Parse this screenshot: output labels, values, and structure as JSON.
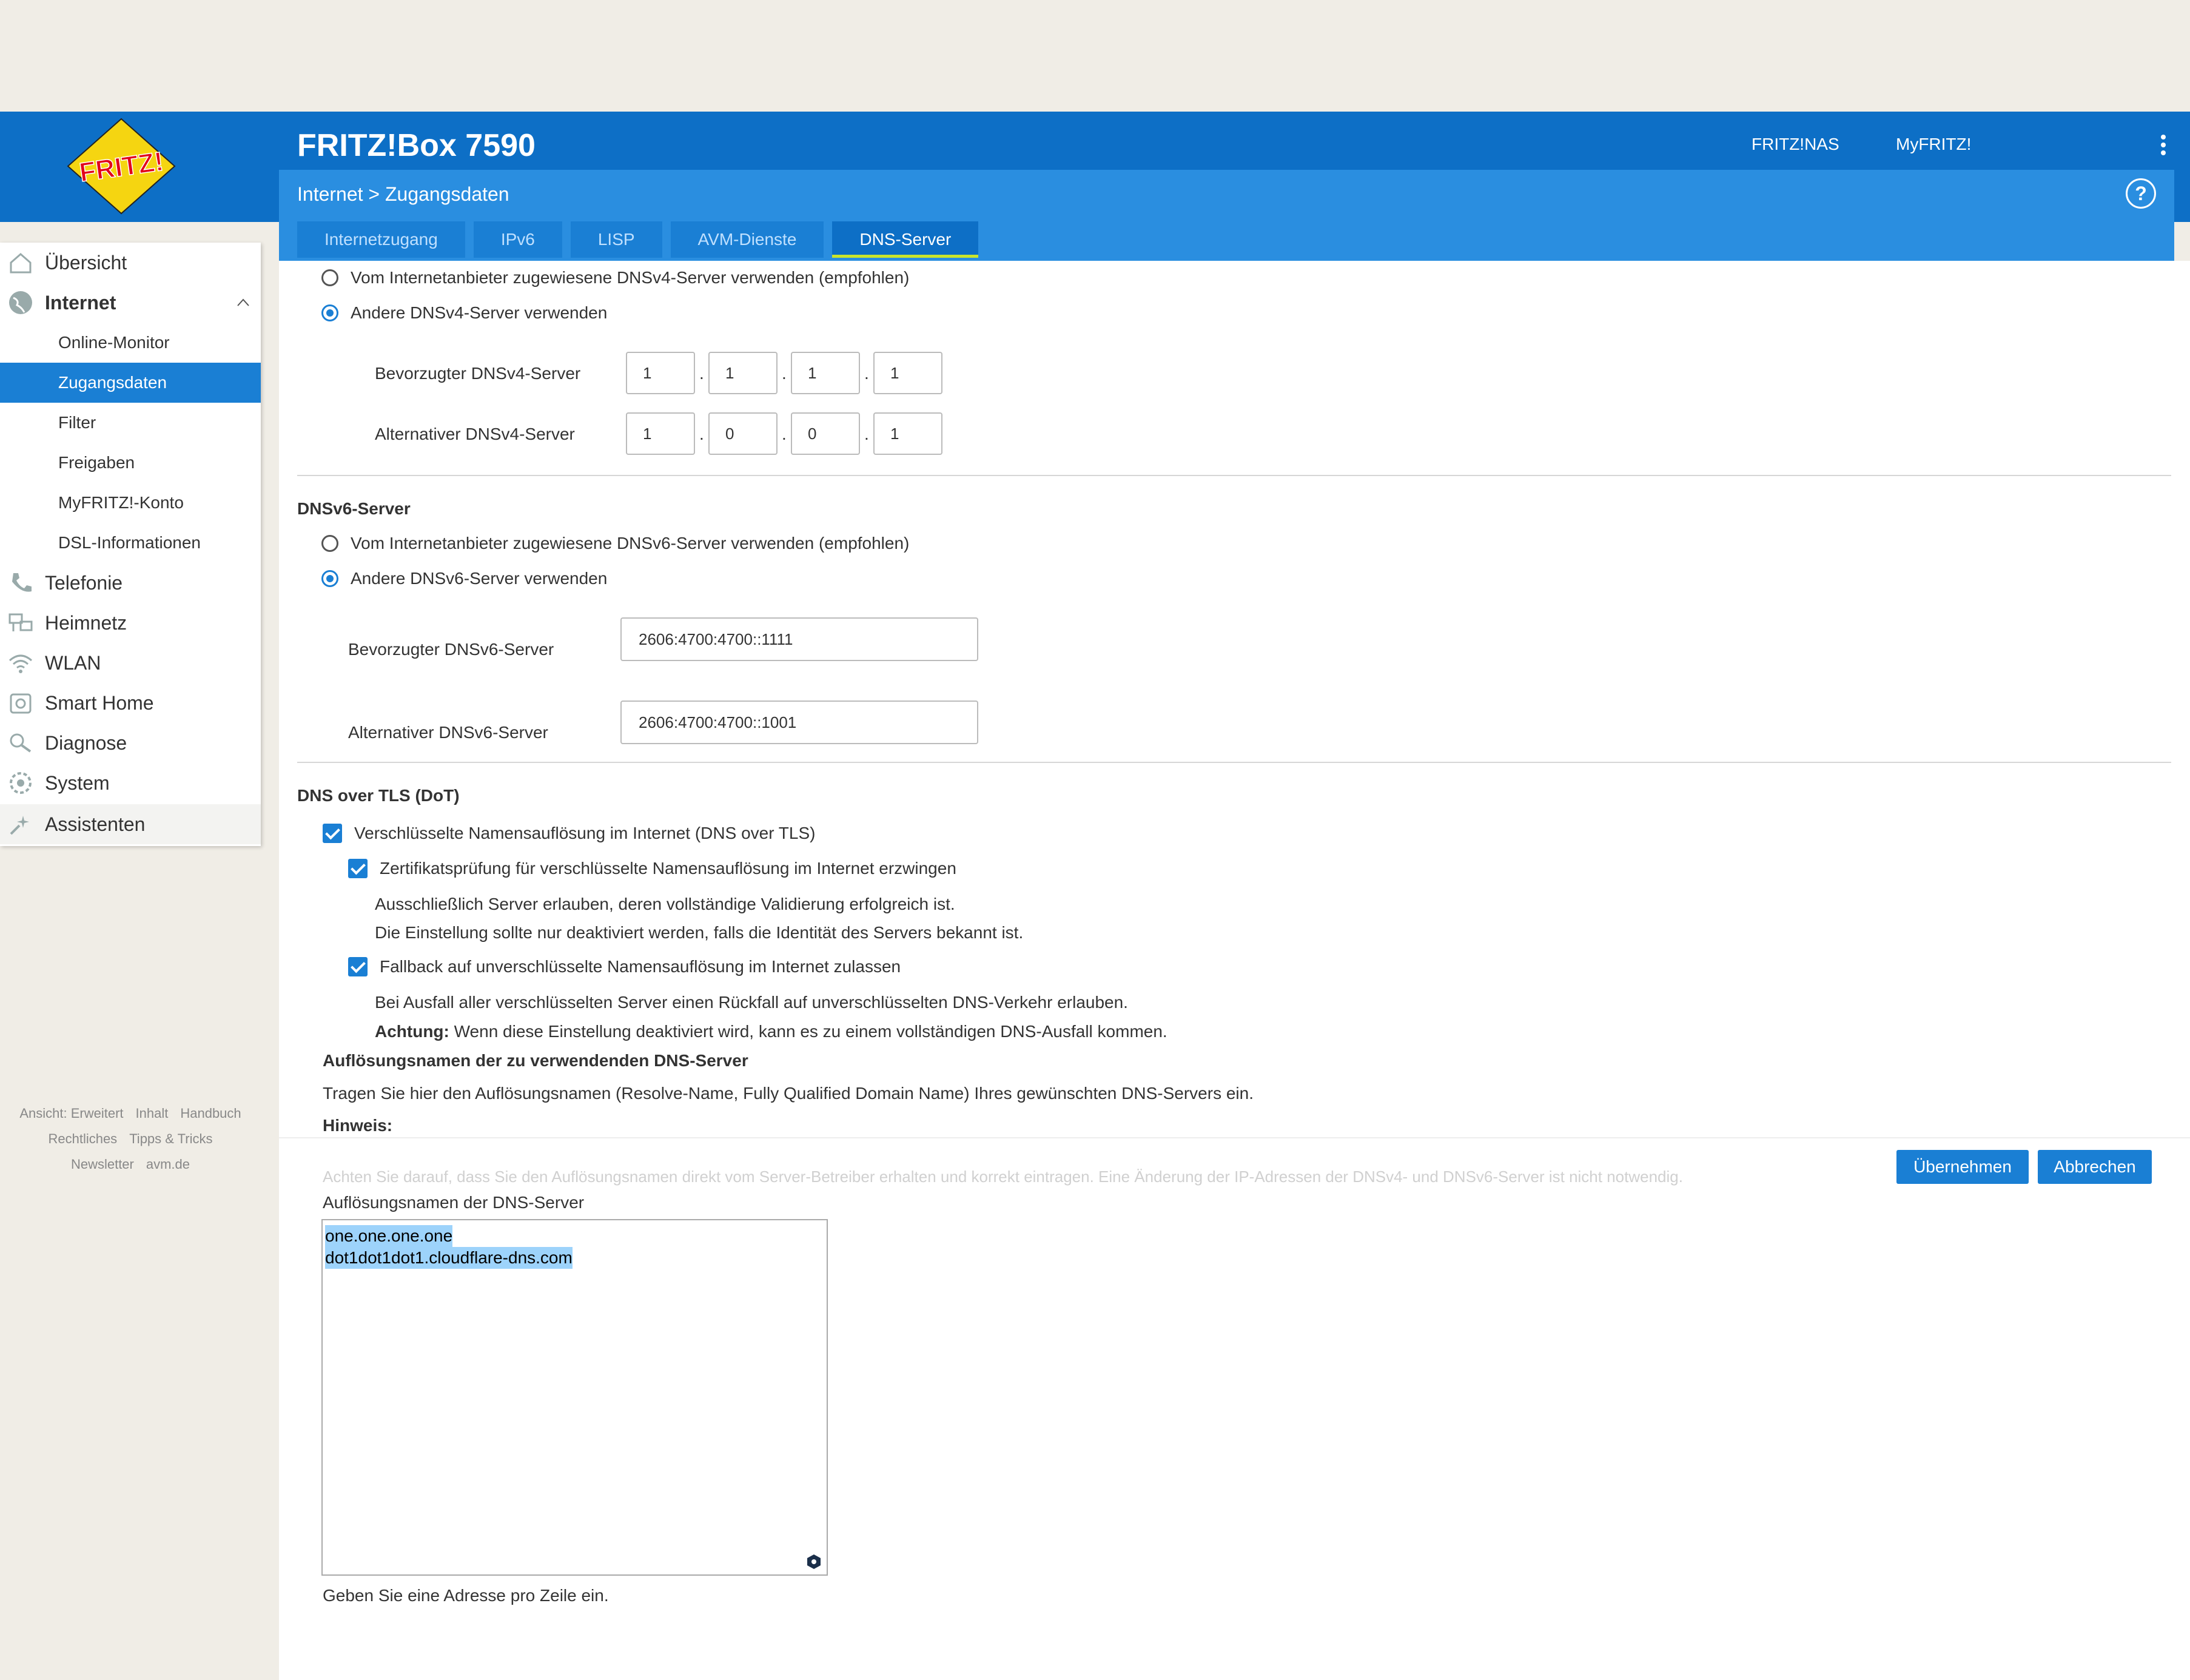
{
  "header": {
    "title": "FRITZ!Box 7590",
    "links": [
      "FRITZ!NAS",
      "MyFRITZ!"
    ],
    "logo_text": "FRITZ!"
  },
  "breadcrumb": {
    "section": "Internet",
    "separator": ">",
    "page": "Zugangsdaten"
  },
  "help_label": "?",
  "tabs": [
    "Internetzugang",
    "IPv6",
    "LISP",
    "AVM-Dienste",
    "DNS-Server"
  ],
  "sidebar": {
    "items": [
      {
        "label": "Übersicht",
        "icon": "home-icon"
      },
      {
        "label": "Internet",
        "icon": "globe-icon"
      },
      {
        "label": "Telefonie",
        "icon": "phone-icon"
      },
      {
        "label": "Heimnetz",
        "icon": "network-icon"
      },
      {
        "label": "WLAN",
        "icon": "wifi-icon"
      },
      {
        "label": "Smart Home",
        "icon": "smart-home-icon"
      },
      {
        "label": "Diagnose",
        "icon": "diagnose-icon"
      },
      {
        "label": "System",
        "icon": "system-icon"
      },
      {
        "label": "Assistenten",
        "icon": "assistant-icon"
      }
    ],
    "sub_items": [
      "Online-Monitor",
      "Zugangsdaten",
      "Filter",
      "Freigaben",
      "MyFRITZ!-Konto",
      "DSL-Informationen"
    ]
  },
  "footer": {
    "line1": [
      "Ansicht: Erweitert",
      "Inhalt",
      "Handbuch"
    ],
    "line2": [
      "Rechtliches",
      "Tipps & Tricks"
    ],
    "line3": [
      "Newsletter",
      "avm.de"
    ]
  },
  "dnsv4": {
    "option_provider": "Vom Internetanbieter zugewiesene DNSv4-Server verwenden (empfohlen)",
    "option_other": "Andere DNSv4-Server verwenden",
    "preferred_label": "Bevorzugter DNSv4-Server",
    "preferred": [
      "1",
      "1",
      "1",
      "1"
    ],
    "alternative_label": "Alternativer DNSv4-Server",
    "alternative": [
      "1",
      "0",
      "0",
      "1"
    ],
    "separator": "."
  },
  "dnsv6": {
    "title": "DNSv6-Server",
    "option_provider": "Vom Internetanbieter zugewiesene DNSv6-Server verwenden (empfohlen)",
    "option_other": "Andere DNSv6-Server verwenden",
    "preferred_label": "Bevorzugter DNSv6-Server",
    "preferred": "2606:4700:4700::1111",
    "alternative_label": "Alternativer DNSv6-Server",
    "alternative": "2606:4700:4700::1001"
  },
  "dot": {
    "title": "DNS over TLS (DoT)",
    "enable_label": "Verschlüsselte Namensauflösung im Internet (DNS over TLS)",
    "cert_label": "Zertifikatsprüfung für verschlüsselte Namensauflösung im Internet erzwingen",
    "cert_desc1": "Ausschließlich Server erlauben, deren vollständige Validierung erfolgreich ist.",
    "cert_desc2": "Die Einstellung sollte nur deaktiviert werden, falls die Identität des Servers bekannt ist.",
    "fallback_label": "Fallback auf unverschlüsselte Namensauflösung im Internet zulassen",
    "fallback_desc1": "Bei Ausfall aller verschlüsselten Server einen Rückfall auf unverschlüsselten DNS-Verkehr erlauben.",
    "fallback_warn_bold": "Achtung:",
    "fallback_warn_rest": " Wenn diese Einstellung deaktiviert wird, kann es zu einem vollständigen DNS-Ausfall kommen.",
    "resolve_title": "Auflösungsnamen der zu verwendenden DNS-Server",
    "resolve_desc": "Tragen Sie hier den Auflösungsnamen (Resolve-Name, Fully Qualified Domain Name) Ihres gewünschten DNS-Servers ein.",
    "hint_title": "Hinweis:",
    "hint_text": "Achten Sie darauf, dass Sie den Auflösungsnamen direkt vom Server-Betreiber erhalten und korrekt eintragen. Eine Änderung der IP-Adressen der DNSv4- und DNSv6-Server ist nicht notwendig.",
    "textarea_label": "Auflösungsnamen der DNS-Server",
    "textarea_lines": [
      "one.one.one.one",
      "dot1dot1dot1.cloudflare-dns.com"
    ],
    "textarea_hint": "Geben Sie eine Adresse pro Zeile ein."
  },
  "buttons": {
    "apply": "Übernehmen",
    "cancel": "Abbrechen"
  }
}
